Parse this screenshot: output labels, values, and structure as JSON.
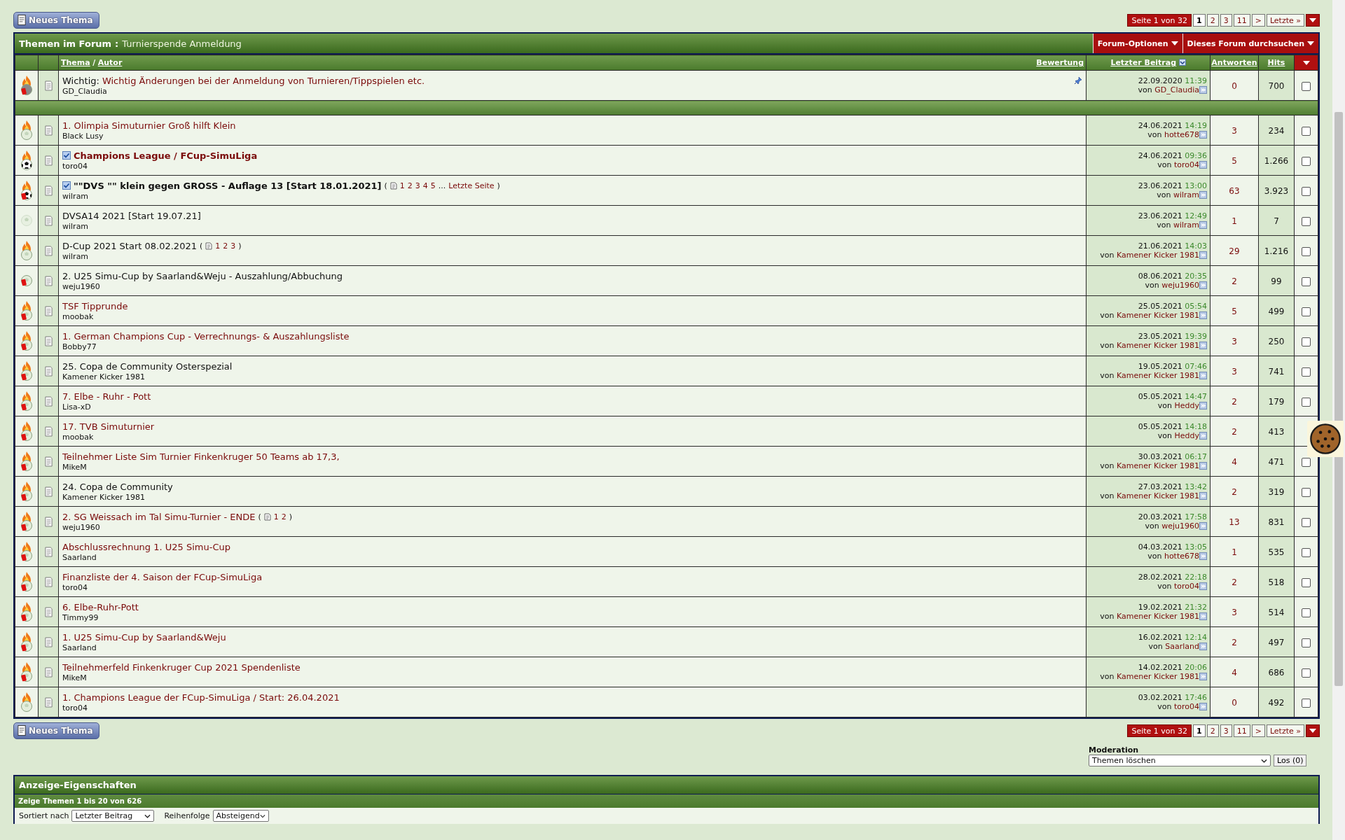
{
  "top_toolbar": {
    "new_thread_button": "Neues Thema",
    "pagination": {
      "label": "Seite 1 von 32",
      "pages": [
        {
          "label": "1",
          "selected": true
        },
        {
          "label": "2",
          "selected": false
        },
        {
          "label": "3",
          "selected": false
        },
        {
          "label": "11",
          "selected": false
        },
        {
          "label": ">",
          "selected": false
        },
        {
          "label": "Letzte »",
          "selected": false
        }
      ]
    }
  },
  "forum_header": {
    "title": "Themen im Forum",
    "separator": ":",
    "forum_name": "Turnierspende Anmeldung",
    "menus": [
      "Forum-Optionen",
      "Dieses Forum durchsuchen"
    ]
  },
  "columns": {
    "thread": "Thema",
    "slash": "/",
    "author": "Autor",
    "rating": "Bewertung",
    "last_post": "Letzter Beitrag",
    "replies": "Antworten",
    "views": "Hits"
  },
  "sticky_threads": [
    {
      "hot": true,
      "kind": "grey",
      "closed": true,
      "subscribed": false,
      "bold": false,
      "visited": true,
      "pinned": true,
      "prefix": "Wichtig:",
      "title": "Wichtig Änderungen bei der Anmeldung von Turnieren/Tippspielen etc.",
      "author": "GD_Claudia",
      "last_post": {
        "date": "22.09.2020",
        "time": "11:39",
        "by": "von",
        "user": "GD_Claudia"
      },
      "replies": "0",
      "views": "700",
      "checked": false
    }
  ],
  "threads": [
    {
      "hot": true,
      "kind": "white",
      "closed": false,
      "subscribed": false,
      "bold": false,
      "visited": true,
      "title": "1. Olimpia Simuturnier Groß hilft Klein",
      "author": "Black Lusy",
      "last_post": {
        "date": "24.06.2021",
        "time": "14:19",
        "by": "von",
        "user": "hotte678"
      },
      "replies": "3",
      "views": "234",
      "checked": false
    },
    {
      "hot": true,
      "kind": "black",
      "closed": false,
      "subscribed": true,
      "bold": true,
      "visited": true,
      "title": "Champions League / FCup-SimuLiga",
      "author": "toro04",
      "last_post": {
        "date": "24.06.2021",
        "time": "09:36",
        "by": "von",
        "user": "toro04"
      },
      "replies": "5",
      "views": "1.266",
      "checked": false
    },
    {
      "hot": true,
      "kind": "black",
      "closed": true,
      "subscribed": true,
      "bold": true,
      "visited": false,
      "title": "\"\"DVS \"\" klein gegen GROSS - Auflage 13 [Start 18.01.2021]",
      "pages": {
        "open": "(",
        "links": [
          "1",
          "2",
          "3",
          "4",
          "5"
        ],
        "ellipsis": "...",
        "last_page": "Letzte Seite",
        "close": ")"
      },
      "author": "wilram",
      "last_post": {
        "date": "23.06.2021",
        "time": "13:00",
        "by": "von",
        "user": "wilram"
      },
      "replies": "63",
      "views": "3.923",
      "checked": false
    },
    {
      "hot": false,
      "kind": "pale",
      "closed": false,
      "subscribed": false,
      "bold": false,
      "visited": false,
      "title": "DVSA14 2021 [Start 19.07.21]",
      "author": "wilram",
      "last_post": {
        "date": "23.06.2021",
        "time": "12:49",
        "by": "von",
        "user": "wilram"
      },
      "replies": "1",
      "views": "7",
      "checked": false
    },
    {
      "hot": true,
      "kind": "white",
      "closed": false,
      "subscribed": false,
      "bold": false,
      "visited": false,
      "title": "D-Cup 2021 Start 08.02.2021",
      "pages": {
        "open": "(",
        "links": [
          "1",
          "2",
          "3"
        ],
        "close": ")"
      },
      "author": "wilram",
      "last_post": {
        "date": "21.06.2021",
        "time": "14:03",
        "by": "von",
        "user": "Kamener Kicker 1981"
      },
      "replies": "29",
      "views": "1.216",
      "checked": false
    },
    {
      "hot": false,
      "kind": "white",
      "closed": true,
      "subscribed": false,
      "bold": false,
      "visited": false,
      "title": "2. U25 Simu-Cup by Saarland&Weju - Auszahlung/Abbuchung",
      "author": "weju1960",
      "last_post": {
        "date": "08.06.2021",
        "time": "20:35",
        "by": "von",
        "user": "weju1960"
      },
      "replies": "2",
      "views": "99",
      "checked": false
    },
    {
      "hot": true,
      "kind": "white",
      "closed": true,
      "subscribed": false,
      "bold": false,
      "visited": true,
      "title": "TSF Tipprunde",
      "author": "moobak",
      "last_post": {
        "date": "25.05.2021",
        "time": "05:54",
        "by": "von",
        "user": "Kamener Kicker 1981"
      },
      "replies": "5",
      "views": "499",
      "checked": false
    },
    {
      "hot": true,
      "kind": "white",
      "closed": true,
      "subscribed": false,
      "bold": false,
      "visited": true,
      "title": "1. German Champions Cup - Verrechnungs- & Auszahlungsliste",
      "author": "Bobby77",
      "last_post": {
        "date": "23.05.2021",
        "time": "19:39",
        "by": "von",
        "user": "Kamener Kicker 1981"
      },
      "replies": "3",
      "views": "250",
      "checked": false
    },
    {
      "hot": true,
      "kind": "white",
      "closed": true,
      "subscribed": false,
      "bold": false,
      "visited": false,
      "title": "25. Copa de Community Osterspezial",
      "author": "Kamener Kicker 1981",
      "last_post": {
        "date": "19.05.2021",
        "time": "07:46",
        "by": "von",
        "user": "Kamener Kicker 1981"
      },
      "replies": "3",
      "views": "741",
      "checked": false
    },
    {
      "hot": true,
      "kind": "white",
      "closed": true,
      "subscribed": false,
      "bold": false,
      "visited": true,
      "title": "7. Elbe - Ruhr - Pott",
      "author": "Lisa-xD",
      "last_post": {
        "date": "05.05.2021",
        "time": "14:47",
        "by": "von",
        "user": "Heddy"
      },
      "replies": "2",
      "views": "179",
      "checked": false
    },
    {
      "hot": true,
      "kind": "white",
      "closed": true,
      "subscribed": false,
      "bold": false,
      "visited": true,
      "title": "17. TVB Simuturnier",
      "author": "moobak",
      "last_post": {
        "date": "05.05.2021",
        "time": "14:18",
        "by": "von",
        "user": "Heddy"
      },
      "replies": "2",
      "views": "413"
    },
    {
      "hot": true,
      "kind": "white",
      "closed": true,
      "subscribed": false,
      "bold": false,
      "visited": true,
      "title": "Teilnehmer Liste Sim Turnier Finkenkruger 50 Teams ab 17,3,",
      "author": "MikeM",
      "last_post": {
        "date": "30.03.2021",
        "time": "06:17",
        "by": "von",
        "user": "Kamener Kicker 1981"
      },
      "replies": "4",
      "views": "471",
      "checked": false
    },
    {
      "hot": true,
      "kind": "white",
      "closed": true,
      "subscribed": false,
      "bold": false,
      "visited": false,
      "title": "24. Copa de Community",
      "author": "Kamener Kicker 1981",
      "last_post": {
        "date": "27.03.2021",
        "time": "13:42",
        "by": "von",
        "user": "Kamener Kicker 1981"
      },
      "replies": "2",
      "views": "319",
      "checked": false
    },
    {
      "hot": true,
      "kind": "white",
      "closed": true,
      "subscribed": false,
      "bold": false,
      "visited": true,
      "title": "2. SG Weissach im Tal Simu-Turnier - ENDE",
      "pages": {
        "open": "(",
        "links": [
          "1",
          "2"
        ],
        "close": ")"
      },
      "author": "weju1960",
      "last_post": {
        "date": "20.03.2021",
        "time": "17:58",
        "by": "von",
        "user": "weju1960"
      },
      "replies": "13",
      "views": "831",
      "checked": false
    },
    {
      "hot": true,
      "kind": "white",
      "closed": true,
      "subscribed": false,
      "bold": false,
      "visited": true,
      "title": "Abschlussrechnung 1. U25 Simu-Cup",
      "author": "Saarland",
      "last_post": {
        "date": "04.03.2021",
        "time": "13:05",
        "by": "von",
        "user": "hotte678"
      },
      "replies": "1",
      "views": "535",
      "checked": false
    },
    {
      "hot": true,
      "kind": "white",
      "closed": true,
      "subscribed": false,
      "bold": false,
      "visited": true,
      "title": "Finanzliste der 4. Saison der FCup-SimuLiga",
      "author": "toro04",
      "last_post": {
        "date": "28.02.2021",
        "time": "22:18",
        "by": "von",
        "user": "toro04"
      },
      "replies": "2",
      "views": "518",
      "checked": false
    },
    {
      "hot": true,
      "kind": "white",
      "closed": true,
      "subscribed": false,
      "bold": false,
      "visited": true,
      "title": "6. Elbe-Ruhr-Pott",
      "author": "Timmy99",
      "last_post": {
        "date": "19.02.2021",
        "time": "21:32",
        "by": "von",
        "user": "Kamener Kicker 1981"
      },
      "replies": "3",
      "views": "514",
      "checked": false
    },
    {
      "hot": true,
      "kind": "white",
      "closed": true,
      "subscribed": false,
      "bold": false,
      "visited": true,
      "title": "1. U25 Simu-Cup by Saarland&Weju",
      "author": "Saarland",
      "last_post": {
        "date": "16.02.2021",
        "time": "12:14",
        "by": "von",
        "user": "Saarland"
      },
      "replies": "2",
      "views": "497",
      "checked": false
    },
    {
      "hot": true,
      "kind": "white",
      "closed": true,
      "subscribed": false,
      "bold": false,
      "visited": true,
      "title": "Teilnehmerfeld Finkenkruger Cup 2021 Spendenliste",
      "author": "MikeM",
      "last_post": {
        "date": "14.02.2021",
        "time": "20:06",
        "by": "von",
        "user": "Kamener Kicker 1981"
      },
      "replies": "4",
      "views": "686",
      "checked": false
    },
    {
      "hot": true,
      "kind": "white",
      "closed": false,
      "subscribed": false,
      "bold": false,
      "visited": true,
      "title": "1. Champions League der FCup-SimuLiga / Start: 26.04.2021",
      "author": "toro04",
      "last_post": {
        "date": "03.02.2021",
        "time": "17:46",
        "by": "von",
        "user": "toro04"
      },
      "replies": "0",
      "views": "492",
      "checked": false
    }
  ],
  "bottom_toolbar": {
    "new_thread_button": "Neues Thema",
    "pagination": {
      "label": "Seite 1 von 32",
      "pages": [
        {
          "label": "1",
          "selected": true
        },
        {
          "label": "2",
          "selected": false
        },
        {
          "label": "3",
          "selected": false
        },
        {
          "label": "11",
          "selected": false
        },
        {
          "label": ">",
          "selected": false
        },
        {
          "label": "Letzte »",
          "selected": false
        }
      ]
    }
  },
  "moderation": {
    "label": "Moderation",
    "action": "Themen löschen",
    "button": "Los (0)"
  },
  "display_options": {
    "title": "Anzeige-Eigenschaften",
    "summary": "Zeige Themen 1 bis 20 von 626",
    "sort_label": "Sortiert nach",
    "sort_value": "Letzter Beitrag",
    "order_label": "Reihenfolge",
    "order_value": "Absteigend"
  }
}
